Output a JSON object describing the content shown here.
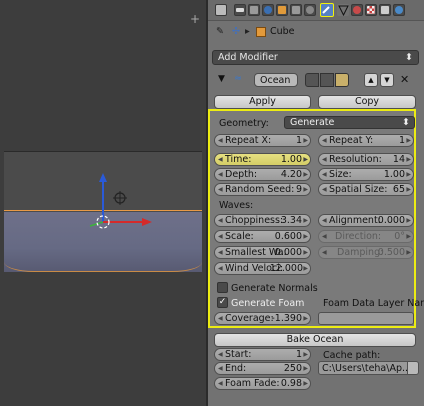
{
  "header": {
    "object_name": "Cube",
    "add_modifier": "Add Modifier"
  },
  "modifier": {
    "name": "Ocean",
    "apply": "Apply",
    "copy": "Copy"
  },
  "geometry": {
    "label": "Geometry:",
    "mode": "Generate"
  },
  "fields": {
    "repeat_x": {
      "label": "Repeat X:",
      "value": "1"
    },
    "repeat_y": {
      "label": "Repeat Y:",
      "value": "1"
    },
    "time": {
      "label": "Time:",
      "value": "1.00"
    },
    "resolution": {
      "label": "Resolution:",
      "value": "14"
    },
    "depth": {
      "label": "Depth:",
      "value": "4.20"
    },
    "size": {
      "label": "Size:",
      "value": "1.00"
    },
    "random_seed": {
      "label": "Random Seed:",
      "value": "9"
    },
    "spatial_size": {
      "label": "Spatial Size:",
      "value": "65"
    },
    "choppiness": {
      "label": "Choppiness:",
      "value": "3.34"
    },
    "alignment": {
      "label": "Alignment:",
      "value": "0.000"
    },
    "scale": {
      "label": "Scale:",
      "value": "0.600"
    },
    "direction": {
      "label": "Direction:",
      "value": "0°"
    },
    "smallest_wave": {
      "label": "Smallest Wa:",
      "value": "0.000"
    },
    "damping": {
      "label": "Damping:",
      "value": "0.500"
    },
    "wind_velocity": {
      "label": "Wind Veloci:",
      "value": "12.000"
    },
    "coverage": {
      "label": "Coverage:",
      "value": "-1.390"
    },
    "start": {
      "label": "Start:",
      "value": "1"
    },
    "end": {
      "label": "End:",
      "value": "250"
    },
    "foam_fade": {
      "label": "Foam Fade:",
      "value": "0.98"
    }
  },
  "waves_label": "Waves:",
  "generate_normals": {
    "label": "Generate Normals",
    "checked": false
  },
  "generate_foam": {
    "label": "Generate Foam",
    "checked": true
  },
  "foam_layer_label": "Foam Data Layer Name:",
  "bake": {
    "button": "Bake Ocean",
    "cache_label": "Cache path:",
    "cache_path": "C:\\Users\\teha\\Ap..."
  },
  "colors": {
    "highlight": "#ecec13",
    "active_tab": "#5680c2"
  },
  "icons": [
    "render-icon",
    "scene-icon",
    "world-icon",
    "object-icon",
    "constraint-icon",
    "modifier-wrench-icon",
    "data-icon",
    "material-icon",
    "texture-icon",
    "particles-icon",
    "physics-icon"
  ]
}
